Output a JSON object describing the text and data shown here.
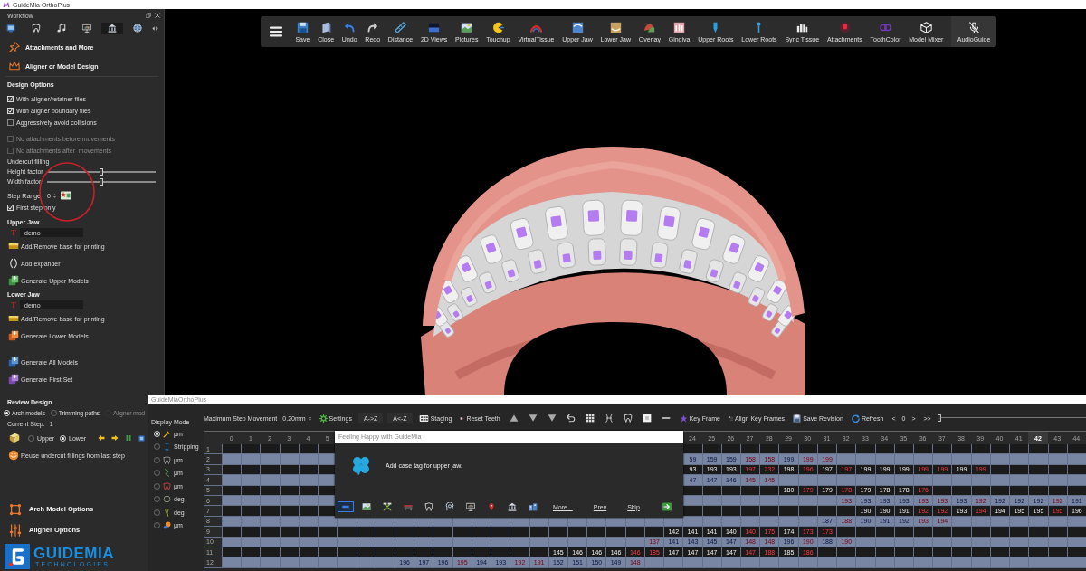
{
  "window": {
    "title": "GuideMia OrthoPlus"
  },
  "workflow": {
    "title": "Workflow",
    "tabs": [
      {
        "selected": false
      },
      {
        "selected": false
      },
      {
        "selected": false
      },
      {
        "selected": false
      },
      {
        "selected": true
      },
      {
        "selected": false
      }
    ],
    "sections": [
      "Attachments and More",
      "Aligner or Model Design"
    ]
  },
  "design_options": {
    "title": "Design Options",
    "checkboxes": [
      {
        "label": "With aligner/retainer files",
        "checked": true,
        "disabled": false
      },
      {
        "label": "With aligner boundary files",
        "checked": true,
        "disabled": false
      },
      {
        "label": "Aggressively avoid collisions",
        "checked": false,
        "disabled": false
      },
      {
        "label": "No attachments before movements",
        "checked": false,
        "disabled": true
      },
      {
        "label": "No attachments after  movements",
        "checked": false,
        "disabled": true
      }
    ],
    "undercut_label": "Undercut filling",
    "sliders": [
      {
        "label": "Height factor",
        "level": 0.5
      },
      {
        "label": "Width factor",
        "level": 0.5
      }
    ],
    "step_range": {
      "label": "Step Range",
      "value": "0"
    },
    "first_step": {
      "label": "First step only",
      "checked": true
    }
  },
  "upper_jaw": {
    "title": "Upper Jaw",
    "tag_icon": "T",
    "case_tag": "demo",
    "actions": [
      "Add/Remove base for printing",
      "Add expander",
      "Generate Upper Models"
    ]
  },
  "lower_jaw": {
    "title": "Lower Jaw",
    "tag_icon": "T",
    "case_tag": "demo",
    "actions": [
      "Add/Remove base for printing",
      "Generate Lower Models"
    ]
  },
  "generate_actions": [
    "Generate All Models",
    "Generate First Set"
  ],
  "review_design": {
    "title": "Review Design",
    "view_options": [
      {
        "label": "Arch models",
        "selected": true,
        "disabled": false
      },
      {
        "label": "Trimming paths",
        "selected": false,
        "disabled": false
      },
      {
        "label": "Aligner mod",
        "selected": false,
        "disabled": true
      }
    ],
    "current_step_label": "Current Step:",
    "current_step": "1",
    "jaw_options": [
      {
        "label": "Upper",
        "selected": false
      },
      {
        "label": "Lower",
        "selected": true
      }
    ],
    "reuse_action": "Reuse undercut fillings from last step"
  },
  "option_sections": [
    "Arch Model Options",
    "Aligner Options"
  ],
  "logo": {
    "name": "GUIDEMIA",
    "tagline": "TECHNOLOGIES"
  },
  "toolbar": {
    "buttons": [
      "Save",
      "Close",
      "Undo",
      "Redo",
      "Distance",
      "2D Views",
      "Pictures",
      "Touchup",
      "VirtualTissue",
      "Upper Jaw",
      "Lower Jaw",
      "Overlay",
      "Gingiva",
      "Upper Roots",
      "Lower Roots",
      "Sync Tissue",
      "Attachments",
      "ToothColor",
      "Model Mixer"
    ],
    "audio_button": "AudioGuide"
  },
  "staging_window": {
    "title": "GuideMiaOrthoPlus",
    "display_mode": {
      "title": "Display Mode",
      "options": [
        {
          "label": "µm",
          "selected": true
        },
        {
          "label": "Stripping",
          "selected": false
        },
        {
          "label": "µm",
          "selected": false
        },
        {
          "label": "µm",
          "selected": false
        },
        {
          "label": "µm",
          "selected": false
        },
        {
          "label": "deg",
          "selected": false
        },
        {
          "label": "deg",
          "selected": false
        },
        {
          "label": "µm",
          "selected": false
        }
      ]
    },
    "toolbar": {
      "max_step_label": "Maximum Step Movement",
      "max_step_value": "0.20mm",
      "settings": "Settings",
      "sort_ascending": "A->Z",
      "sort_descending": "A<-Z",
      "staging": "Staging",
      "reset_teeth": "Reset Teeth",
      "key_frame": "Key Frame",
      "align_key_frames": "Align Key Frames",
      "save_revision": "Save Revision",
      "refresh": "Refresh",
      "step_prev": "<",
      "step_value": "0",
      "step_next": ">",
      "step_last": ">>",
      "timeline": {
        "level": 0
      }
    },
    "table": {
      "columns": [
        {
          "label": "0",
          "selected": false
        },
        {
          "label": "1",
          "selected": false
        },
        {
          "label": "2",
          "selected": false
        },
        {
          "label": "3",
          "selected": false
        },
        {
          "label": "4",
          "selected": false
        },
        {
          "label": "5",
          "selected": false
        },
        null,
        null,
        null,
        null,
        null,
        null,
        null,
        null,
        null,
        null,
        null,
        null,
        null,
        null,
        null,
        null,
        null,
        null,
        {
          "label": "24",
          "selected": false
        },
        {
          "label": "25",
          "selected": false
        },
        {
          "label": "26",
          "selected": false
        },
        {
          "label": "27",
          "selected": false
        },
        {
          "label": "28",
          "selected": false
        },
        {
          "label": "29",
          "selected": false
        },
        {
          "label": "30",
          "selected": false
        },
        {
          "label": "31",
          "selected": false
        },
        {
          "label": "32",
          "selected": false
        },
        {
          "label": "33",
          "selected": false
        },
        {
          "label": "34",
          "selected": false
        },
        {
          "label": "35",
          "selected": false
        },
        {
          "label": "36",
          "selected": false
        },
        {
          "label": "37",
          "selected": false
        },
        {
          "label": "38",
          "selected": false
        },
        {
          "label": "39",
          "selected": false
        },
        {
          "label": "40",
          "selected": false
        },
        {
          "label": "41",
          "selected": false
        },
        {
          "label": "42",
          "selected": true
        },
        {
          "label": "43",
          "selected": false
        },
        {
          "label": "44",
          "selected": false
        }
      ],
      "rows": [
        {
          "label": "1",
          "cells": [
            null,
            null,
            null,
            null,
            null,
            null,
            null,
            null,
            null,
            null,
            null,
            null,
            null,
            null,
            null,
            null,
            null,
            null,
            null,
            null,
            null,
            null,
            null,
            null,
            null,
            null,
            null,
            null,
            null,
            null,
            null,
            null,
            null,
            null,
            null,
            null,
            null,
            null,
            null,
            null,
            null,
            null,
            null,
            null,
            null
          ]
        },
        {
          "label": "2",
          "cells": [
            null,
            null,
            null,
            null,
            null,
            null,
            null,
            null,
            null,
            null,
            null,
            null,
            null,
            null,
            null,
            null,
            null,
            null,
            null,
            null,
            null,
            null,
            null,
            null,
            {
              "value": "59",
              "alert": false
            },
            {
              "value": "159",
              "alert": false
            },
            {
              "value": "159",
              "alert": false
            },
            {
              "value": "158",
              "alert": true
            },
            {
              "value": "158",
              "alert": true
            },
            {
              "value": "199",
              "alert": false
            },
            {
              "value": "199",
              "alert": true
            },
            {
              "value": "199",
              "alert": true
            },
            null,
            null,
            null,
            null,
            null,
            null,
            null,
            null,
            null,
            null,
            null,
            null,
            null
          ]
        },
        {
          "label": "3",
          "cells": [
            null,
            null,
            null,
            null,
            null,
            null,
            null,
            null,
            null,
            null,
            null,
            null,
            null,
            null,
            null,
            null,
            null,
            null,
            null,
            null,
            null,
            null,
            null,
            null,
            {
              "value": "93",
              "alert": false
            },
            {
              "value": "193",
              "alert": false
            },
            {
              "value": "193",
              "alert": false
            },
            {
              "value": "197",
              "alert": true
            },
            {
              "value": "232",
              "alert": true
            },
            {
              "value": "198",
              "alert": false
            },
            {
              "value": "196",
              "alert": true
            },
            {
              "value": "197",
              "alert": false
            },
            {
              "value": "197",
              "alert": true
            },
            {
              "value": "199",
              "alert": false
            },
            {
              "value": "199",
              "alert": false
            },
            {
              "value": "199",
              "alert": false
            },
            {
              "value": "199",
              "alert": true
            },
            {
              "value": "199",
              "alert": true
            },
            {
              "value": "199",
              "alert": false
            },
            {
              "value": "199",
              "alert": true
            },
            null,
            null,
            null,
            null,
            null
          ]
        },
        {
          "label": "4",
          "cells": [
            null,
            null,
            null,
            null,
            null,
            null,
            null,
            null,
            null,
            null,
            null,
            null,
            null,
            null,
            null,
            null,
            null,
            null,
            null,
            null,
            null,
            null,
            null,
            null,
            {
              "value": "47",
              "alert": false
            },
            {
              "value": "147",
              "alert": false
            },
            {
              "value": "146",
              "alert": false
            },
            {
              "value": "145",
              "alert": true
            },
            {
              "value": "145",
              "alert": true
            },
            null,
            null,
            null,
            null,
            null,
            null,
            null,
            null,
            null,
            null,
            null,
            null,
            null,
            null,
            null,
            null
          ]
        },
        {
          "label": "5",
          "cells": [
            null,
            null,
            null,
            null,
            null,
            null,
            null,
            null,
            null,
            null,
            null,
            null,
            null,
            null,
            null,
            null,
            null,
            null,
            null,
            null,
            null,
            null,
            null,
            null,
            null,
            null,
            null,
            null,
            null,
            {
              "value": "180",
              "alert": false
            },
            {
              "value": "179",
              "alert": true
            },
            {
              "value": "179",
              "alert": false
            },
            {
              "value": "178",
              "alert": true
            },
            {
              "value": "179",
              "alert": false
            },
            {
              "value": "178",
              "alert": false
            },
            {
              "value": "178",
              "alert": false
            },
            {
              "value": "176",
              "alert": true
            },
            null,
            null,
            null,
            null,
            null,
            null,
            null,
            null
          ]
        },
        {
          "label": "6",
          "cells": [
            null,
            null,
            null,
            null,
            null,
            null,
            null,
            null,
            null,
            null,
            null,
            null,
            null,
            null,
            null,
            null,
            null,
            null,
            null,
            null,
            null,
            null,
            null,
            null,
            null,
            null,
            null,
            null,
            null,
            null,
            null,
            null,
            {
              "value": "193",
              "alert": true
            },
            {
              "value": "193",
              "alert": false
            },
            {
              "value": "193",
              "alert": false
            },
            {
              "value": "193",
              "alert": false
            },
            {
              "value": "193",
              "alert": true
            },
            {
              "value": "193",
              "alert": true
            },
            {
              "value": "193",
              "alert": false
            },
            {
              "value": "192",
              "alert": true
            },
            {
              "value": "192",
              "alert": false
            },
            {
              "value": "192",
              "alert": false
            },
            {
              "value": "192",
              "alert": false
            },
            {
              "value": "192",
              "alert": true
            },
            {
              "value": "191",
              "alert": false
            }
          ]
        },
        {
          "label": "7",
          "cells": [
            null,
            null,
            null,
            null,
            null,
            null,
            null,
            null,
            null,
            null,
            null,
            null,
            null,
            null,
            null,
            null,
            null,
            null,
            null,
            null,
            null,
            null,
            null,
            null,
            null,
            null,
            null,
            null,
            null,
            null,
            null,
            null,
            null,
            {
              "value": "190",
              "alert": false
            },
            {
              "value": "190",
              "alert": false
            },
            {
              "value": "191",
              "alert": false
            },
            {
              "value": "192",
              "alert": true
            },
            {
              "value": "192",
              "alert": true
            },
            {
              "value": "193",
              "alert": false
            },
            {
              "value": "194",
              "alert": true
            },
            {
              "value": "194",
              "alert": false
            },
            {
              "value": "195",
              "alert": false
            },
            {
              "value": "195",
              "alert": false
            },
            {
              "value": "195",
              "alert": true
            },
            {
              "value": "196",
              "alert": false
            }
          ]
        },
        {
          "label": "8",
          "cells": [
            null,
            null,
            null,
            null,
            null,
            null,
            null,
            null,
            null,
            null,
            null,
            null,
            null,
            null,
            null,
            null,
            null,
            null,
            null,
            null,
            null,
            null,
            null,
            null,
            null,
            null,
            null,
            null,
            null,
            null,
            null,
            {
              "value": "187",
              "alert": false
            },
            {
              "value": "188",
              "alert": true
            },
            {
              "value": "190",
              "alert": false
            },
            {
              "value": "191",
              "alert": false
            },
            {
              "value": "192",
              "alert": false
            },
            {
              "value": "193",
              "alert": true
            },
            {
              "value": "194",
              "alert": true
            },
            null,
            null,
            null,
            null,
            null,
            null,
            null
          ]
        },
        {
          "label": "9",
          "cells": [
            null,
            null,
            null,
            null,
            null,
            null,
            null,
            null,
            null,
            null,
            null,
            null,
            null,
            null,
            null,
            null,
            null,
            null,
            null,
            null,
            null,
            null,
            null,
            {
              "value": "142",
              "alert": false
            },
            {
              "value": "141",
              "alert": false
            },
            {
              "value": "141",
              "alert": false
            },
            {
              "value": "140",
              "alert": false
            },
            {
              "value": "140",
              "alert": true
            },
            {
              "value": "175",
              "alert": true
            },
            {
              "value": "174",
              "alert": false
            },
            {
              "value": "173",
              "alert": true
            },
            {
              "value": "173",
              "alert": true
            },
            null,
            null,
            null,
            null,
            null,
            null,
            null,
            null,
            null,
            null,
            null,
            null,
            null
          ]
        },
        {
          "label": "10",
          "cells": [
            null,
            null,
            null,
            null,
            null,
            null,
            null,
            null,
            null,
            null,
            null,
            null,
            null,
            null,
            null,
            null,
            null,
            null,
            null,
            null,
            null,
            null,
            {
              "value": "137",
              "alert": true
            },
            {
              "value": "141",
              "alert": false
            },
            {
              "value": "143",
              "alert": false
            },
            {
              "value": "145",
              "alert": false
            },
            {
              "value": "147",
              "alert": false
            },
            {
              "value": "148",
              "alert": true
            },
            {
              "value": "148",
              "alert": true
            },
            {
              "value": "196",
              "alert": false
            },
            {
              "value": "190",
              "alert": true
            },
            {
              "value": "188",
              "alert": false
            },
            {
              "value": "190",
              "alert": true
            },
            null,
            null,
            null,
            null,
            null,
            null,
            null,
            null,
            null,
            null,
            null,
            null
          ]
        },
        {
          "label": "11",
          "cells": [
            null,
            null,
            null,
            null,
            null,
            null,
            null,
            null,
            null,
            null,
            null,
            null,
            null,
            null,
            null,
            null,
            null,
            {
              "value": "145",
              "alert": false
            },
            {
              "value": "146",
              "alert": false
            },
            {
              "value": "146",
              "alert": false
            },
            {
              "value": "146",
              "alert": false
            },
            {
              "value": "146",
              "alert": true
            },
            {
              "value": "185",
              "alert": true
            },
            {
              "value": "147",
              "alert": false
            },
            {
              "value": "147",
              "alert": false
            },
            {
              "value": "147",
              "alert": false
            },
            {
              "value": "147",
              "alert": false
            },
            {
              "value": "147",
              "alert": true
            },
            {
              "value": "188",
              "alert": true
            },
            {
              "value": "185",
              "alert": false
            },
            {
              "value": "186",
              "alert": true
            },
            null,
            null,
            null,
            null,
            null,
            null,
            null,
            null,
            null,
            null,
            null,
            null,
            null,
            null
          ]
        },
        {
          "label": "12",
          "cells": [
            null,
            null,
            null,
            null,
            null,
            null,
            null,
            null,
            null,
            {
              "value": "196",
              "alert": false
            },
            {
              "value": "197",
              "alert": false
            },
            {
              "value": "196",
              "alert": false
            },
            {
              "value": "195",
              "alert": true
            },
            {
              "value": "194",
              "alert": false
            },
            {
              "value": "193",
              "alert": false
            },
            {
              "value": "192",
              "alert": true
            },
            {
              "value": "191",
              "alert": true
            },
            {
              "value": "152",
              "alert": false
            },
            {
              "value": "151",
              "alert": false
            },
            {
              "value": "150",
              "alert": false
            },
            {
              "value": "149",
              "alert": false
            },
            {
              "value": "148",
              "alert": true
            },
            null,
            null,
            null,
            null,
            null,
            null,
            null,
            null,
            null,
            null,
            null,
            null,
            null,
            null,
            null,
            null,
            null,
            null,
            null,
            null,
            null
          ]
        }
      ]
    },
    "tip_popup": {
      "title": "Feeling Happy with GuideMia",
      "message": "Add case tag for upper jaw.",
      "icons": [
        {
          "selected": true
        },
        {
          "selected": false
        },
        {
          "selected": false
        },
        {
          "selected": false
        },
        {
          "selected": false
        },
        {
          "selected": false
        },
        {
          "selected": false
        },
        {
          "selected": false
        },
        {
          "selected": false
        },
        {
          "selected": false
        }
      ],
      "links": [
        "More...",
        "Prev",
        "Skip"
      ]
    }
  }
}
